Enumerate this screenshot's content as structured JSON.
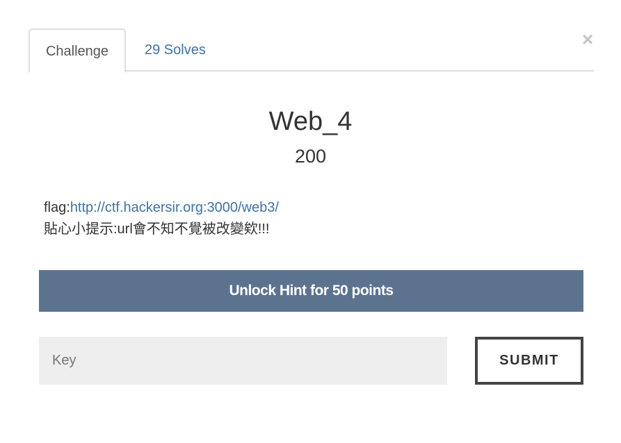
{
  "tabs": {
    "challenge": "Challenge",
    "solves": "29 Solves"
  },
  "close_label": "×",
  "challenge": {
    "name": "Web_4",
    "points": "200",
    "description_prefix": "flag:",
    "description_link": "http://ctf.hackersir.org:3000/web3/",
    "description_line2": "貼心小提示:url會不知不覺被改變欸!!!"
  },
  "hint_button": "Unlock Hint for 50 points",
  "key_input": {
    "placeholder": "Key",
    "value": ""
  },
  "submit_button": "SUBMIT",
  "colors": {
    "link": "#3e72a4",
    "hint_bg": "#5c738f",
    "input_bg": "#eeeeee"
  }
}
